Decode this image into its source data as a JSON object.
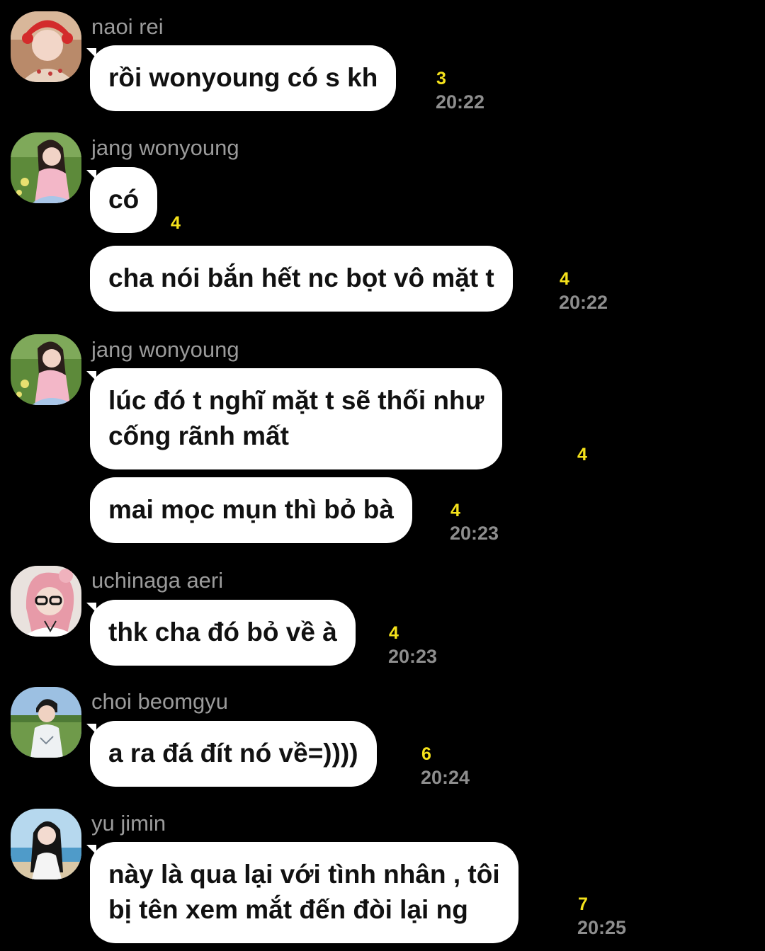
{
  "colors": {
    "background": "#000000",
    "bubble": "#ffffff",
    "unread": "#f5e21b",
    "meta": "#8e8e8e"
  },
  "messages": [
    {
      "sender": "naoi rei",
      "avatar": "avatar-naoi-rei",
      "text": "rồi wonyoung có s kh",
      "unread": "3",
      "time": "20:22"
    },
    {
      "sender": "jang wonyoung",
      "avatar": "avatar-jang-wonyoung",
      "text": "có",
      "unread": "4",
      "time": ""
    },
    {
      "sender": "",
      "avatar": "",
      "text": "cha nói bắn hết nc bọt vô mặt t",
      "unread": "4",
      "time": "20:22"
    },
    {
      "sender": "jang wonyoung",
      "avatar": "avatar-jang-wonyoung",
      "text": "lúc đó t nghĩ mặt t sẽ thối như\ncống rãnh mất",
      "unread": "4",
      "time": ""
    },
    {
      "sender": "",
      "avatar": "",
      "text": "mai mọc mụn thì bỏ bà",
      "unread": "4",
      "time": "20:23"
    },
    {
      "sender": "uchinaga aeri",
      "avatar": "avatar-uchinaga-aeri",
      "text": "thk cha đó bỏ về à",
      "unread": "4",
      "time": "20:23"
    },
    {
      "sender": "choi beomgyu",
      "avatar": "avatar-choi-beomgyu",
      "text": "a ra đá đít nó về=))))",
      "unread": "6",
      "time": "20:24"
    },
    {
      "sender": "yu jimin",
      "avatar": "avatar-yu-jimin",
      "text": "này là qua lại với tình nhân , tôi\nbị tên xem mắt đến đòi lại ng",
      "unread": "7",
      "time": "20:25"
    }
  ]
}
